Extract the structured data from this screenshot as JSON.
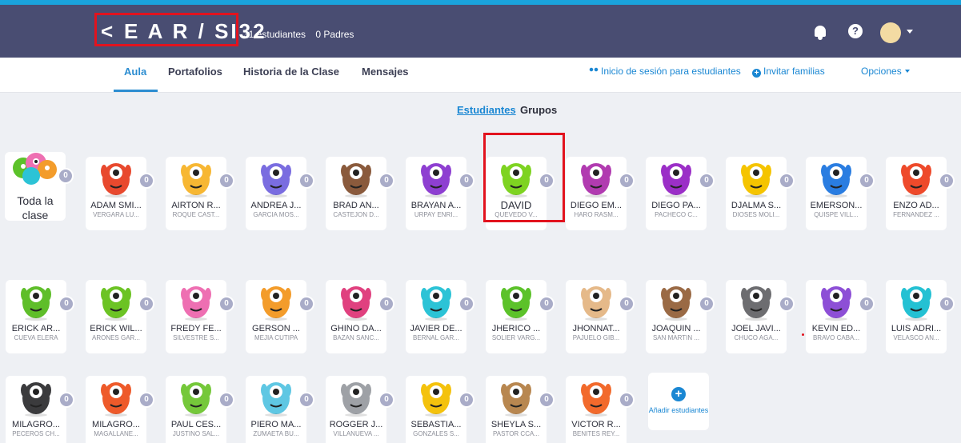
{
  "header": {
    "back_icon": "<",
    "class_name": "E A R / SI32",
    "students_count": "31 estudiantes",
    "parents_count": "0 Padres",
    "bell_icon": "bell-icon",
    "help_icon": "?",
    "avatar_icon": "avatar",
    "colors": {
      "bar": "#494d72",
      "stripe": "#1aa3dc",
      "highlight": "#e2131e"
    }
  },
  "nav": {
    "tabs": [
      "Aula",
      "Portafolios",
      "Historia de la Clase",
      "Mensajes"
    ],
    "active_tab": "Aula",
    "student_login": "Inicio de sesión para estudiantes",
    "invite_families": "Invitar familias",
    "options": "Opciones"
  },
  "view_toggle": {
    "students": "Estudiantes",
    "groups": "Grupos"
  },
  "whole_class": {
    "label": "Toda la clase",
    "points": "0"
  },
  "students": [
    {
      "name": "ADAM SMI...",
      "surname": "VERGARA LU...",
      "points": "0",
      "color": "#e8492e"
    },
    {
      "name": "AIRTON R...",
      "surname": "ROQUE CAST...",
      "points": "0",
      "color": "#f7b733"
    },
    {
      "name": "ANDREA J...",
      "surname": "GARCIA MOS...",
      "points": "0",
      "color": "#7a6de0"
    },
    {
      "name": "BRAD AN...",
      "surname": "CASTEJON D...",
      "points": "0",
      "color": "#8a5a3c"
    },
    {
      "name": "BRAYAN A...",
      "surname": "URPAY ENRI...",
      "points": "0",
      "color": "#8e3fd1"
    },
    {
      "name": "DAVID",
      "surname": "QUEVEDO V...",
      "points": "0",
      "color": "#7ed321"
    },
    {
      "name": "DIEGO EM...",
      "surname": "HARO RASM...",
      "points": "0",
      "color": "#b13bb0"
    },
    {
      "name": "DIEGO PA...",
      "surname": "PACHECO C...",
      "points": "0",
      "color": "#9b2fc7"
    },
    {
      "name": "DJALMA S...",
      "surname": "DIOSES MOLI...",
      "points": "0",
      "color": "#f5c400"
    },
    {
      "name": "EMERSON...",
      "surname": "QUISPE VILL...",
      "points": "0",
      "color": "#2a7de1"
    },
    {
      "name": "ENZO AD...",
      "surname": "FERNANDEZ ...",
      "points": "0",
      "color": "#ee4a2b"
    },
    {
      "name": "ERICK AR...",
      "surname": "CUEVA ELERA",
      "points": "0",
      "color": "#5fbe2a"
    },
    {
      "name": "ERICK WIL...",
      "surname": "ARONES GAR...",
      "points": "0",
      "color": "#6cc324"
    },
    {
      "name": "FREDY FE...",
      "surname": "SILVESTRE S...",
      "points": "0",
      "color": "#ee6fb2"
    },
    {
      "name": "GERSON ...",
      "surname": "MEJIA CUTIPA",
      "points": "0",
      "color": "#f39c2b"
    },
    {
      "name": "GHINO DA...",
      "surname": "BAZAN SANC...",
      "points": "0",
      "color": "#e0417f"
    },
    {
      "name": "JAVIER DE...",
      "surname": "BERNAL GAR...",
      "points": "0",
      "color": "#2cc3d6"
    },
    {
      "name": "JHERICO ...",
      "surname": "SOLIER VARG...",
      "points": "0",
      "color": "#5cc22a"
    },
    {
      "name": "JHONNAT...",
      "surname": "PAJUELO GIB...",
      "points": "0",
      "color": "#e5b989"
    },
    {
      "name": "JOAQUIN ...",
      "surname": "SAN MARTIN ...",
      "points": "0",
      "color": "#9a6a45"
    },
    {
      "name": "JOEL JAVI...",
      "surname": "CHUCO AGA...",
      "points": "0",
      "color": "#6d6d70"
    },
    {
      "name": "KEVIN ED...",
      "surname": "BRAVO CABA...",
      "points": "0",
      "color": "#8d4fd6"
    },
    {
      "name": "LUIS ADRI...",
      "surname": "VELASCO AN...",
      "points": "0",
      "color": "#24c1d3"
    },
    {
      "name": "MILAGRO...",
      "surname": "PECEROS CH...",
      "points": "0",
      "color": "#3b3b3d"
    },
    {
      "name": "MILAGRO...",
      "surname": "MAGALLANE...",
      "points": "0",
      "color": "#ee5a2a"
    },
    {
      "name": "PAUL CES...",
      "surname": "JUSTINO SAL...",
      "points": "0",
      "color": "#75c83a"
    },
    {
      "name": "PIERO MA...",
      "surname": "ZUMAETA BU...",
      "points": "0",
      "color": "#5fc7e3"
    },
    {
      "name": "ROGGER J...",
      "surname": "VILLANUEVA ...",
      "points": "0",
      "color": "#9ea1a6"
    },
    {
      "name": "SEBASTIA...",
      "surname": "GONZALES S...",
      "points": "0",
      "color": "#f4c20d"
    },
    {
      "name": "SHEYLA S...",
      "surname": "PASTOR CCA...",
      "points": "0",
      "color": "#b88750"
    },
    {
      "name": "VICTOR R...",
      "surname": "BENITES REY...",
      "points": "0",
      "color": "#f26a2c"
    }
  ],
  "add_students": {
    "label": "Añadir estudiantes",
    "icon": "+"
  }
}
